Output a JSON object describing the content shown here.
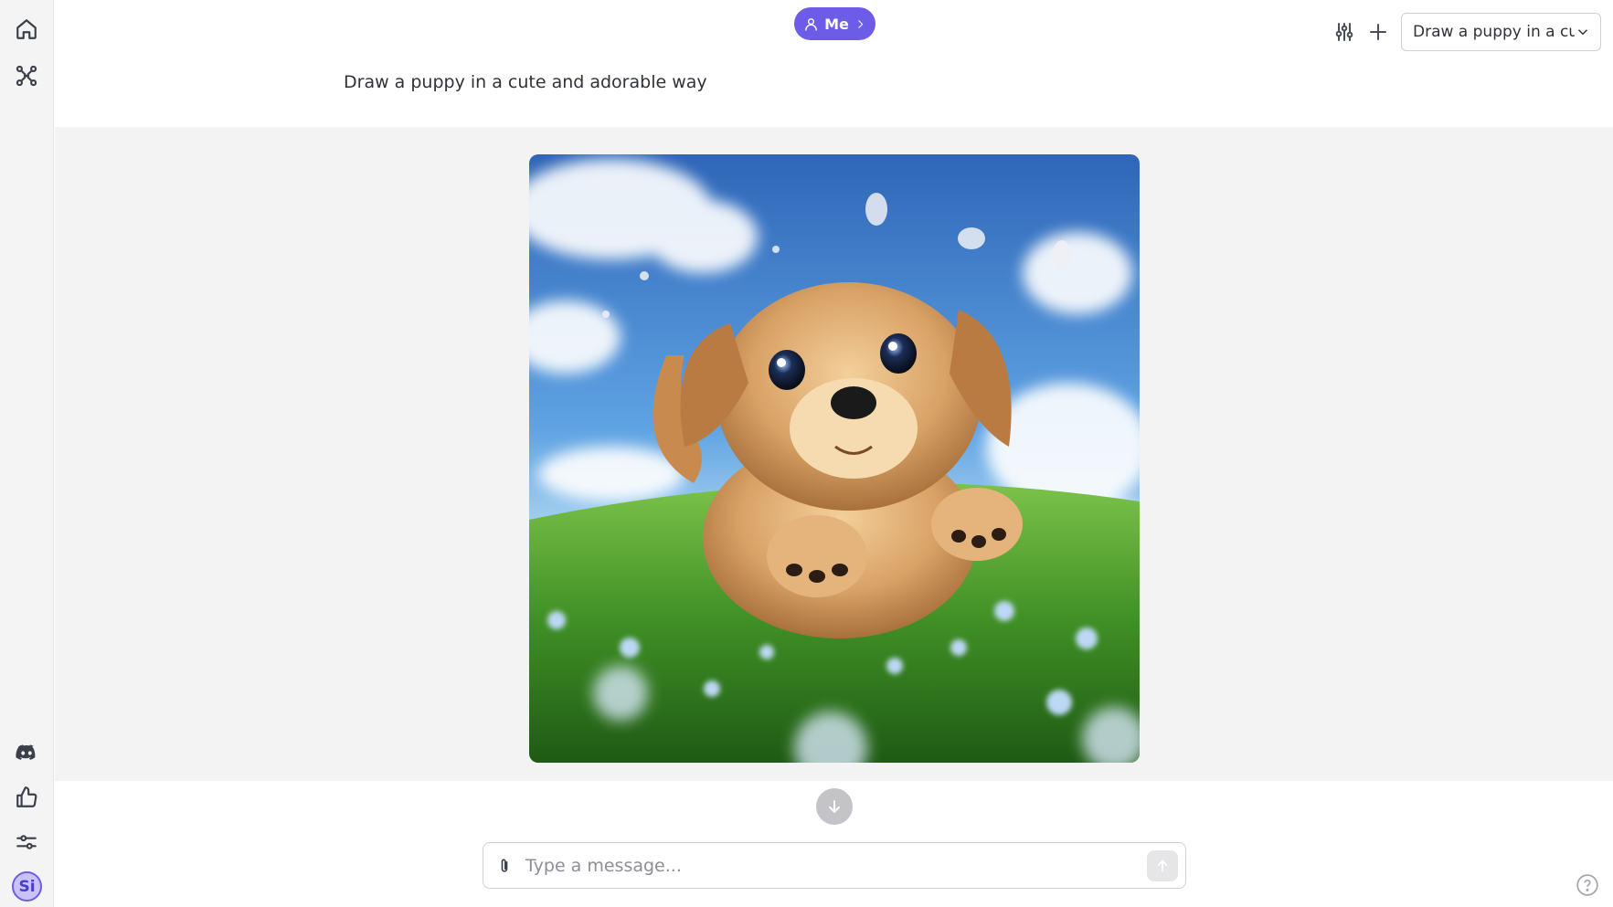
{
  "sidebar": {
    "items": [
      {
        "icon": "home-icon"
      },
      {
        "icon": "workflow-icon"
      },
      {
        "icon": "discord-icon"
      },
      {
        "icon": "thumbs-up-icon"
      },
      {
        "icon": "sliders-icon"
      }
    ],
    "avatar_initials": "Si"
  },
  "header": {
    "persona_label": "Me",
    "prompt": "Draw a puppy in a cute and adorable way",
    "conversation_select": {
      "value": "Draw a puppy in a cute and adorable way"
    }
  },
  "main": {
    "image": {
      "icon": "generated-image"
    }
  },
  "composer": {
    "placeholder": "Type a message...",
    "value": ""
  },
  "colors": {
    "accent": "#6c5ce7",
    "sidebar_bg": "#f4f4f5",
    "content_bg": "#f3f3f4"
  }
}
